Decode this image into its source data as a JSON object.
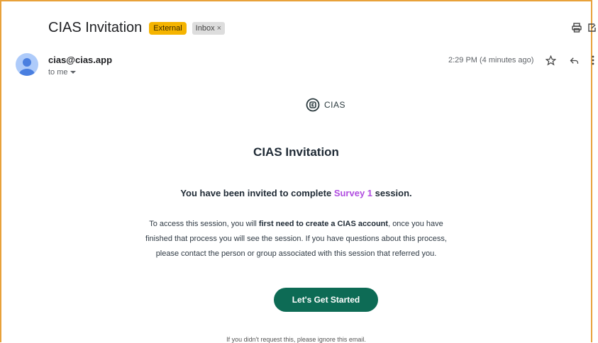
{
  "email": {
    "subject": "CIAS Invitation",
    "labels": {
      "external": "External",
      "inbox": "Inbox",
      "remove_glyph": "×"
    },
    "sender": "cias@cias.app",
    "recipient_text": "to me",
    "timestamp": "2:29 PM (4 minutes ago)"
  },
  "icons": {
    "print": "print-icon",
    "open_new_window": "open-in-new-window-icon",
    "star": "star-icon",
    "reply": "reply-icon",
    "more": "more-vertical-icon",
    "avatar": "default-avatar-icon",
    "dropdown": "chevron-down-icon"
  },
  "body": {
    "brand": "CIAS",
    "title": "CIAS Invitation",
    "invite_prefix": "You have been invited to complete ",
    "session_name": "Survey 1",
    "invite_suffix": " session.",
    "para_part1": "To access this session, you will ",
    "para_bold": "first need to create a CIAS account",
    "para_part2": ", once you have finished that process you will see the session. If you have questions about this process, please contact the person or group associated with this session that referred you.",
    "cta_label": "Let's Get Started",
    "footer_note": "If you didn't request this, please ignore this email."
  },
  "colors": {
    "external_badge": "#f5b400",
    "cta": "#0d6b55",
    "session_highlight": "#b04de0",
    "frame_border": "#e8a13a"
  }
}
